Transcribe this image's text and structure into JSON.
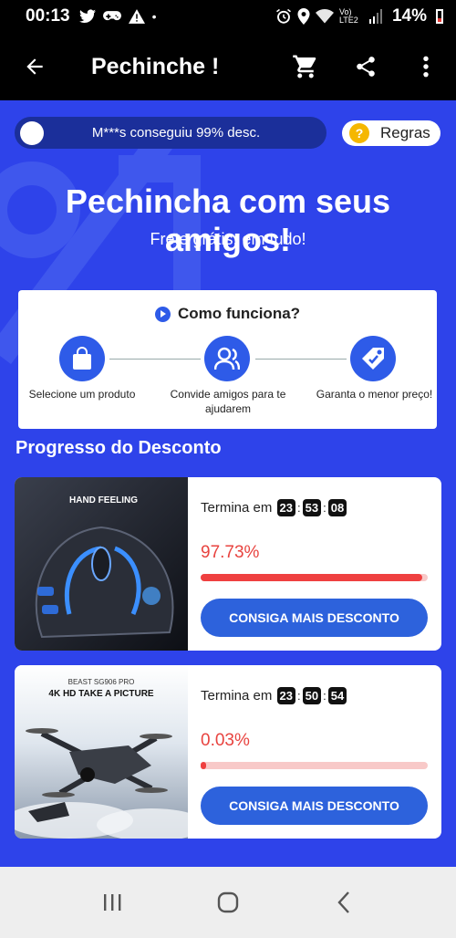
{
  "status_bar": {
    "time": "00:13",
    "network_label": "Vo) LTE2",
    "battery": "14%"
  },
  "app_bar": {
    "title": "Pechinche !"
  },
  "ticker": {
    "text": "M***s conseguiu 99% desc."
  },
  "rules": {
    "icon_char": "?",
    "label": "Regras"
  },
  "hero": {
    "title": "Pechincha com seus amigos!",
    "subtitle": "Frete grátis, em tudo!"
  },
  "how_it_works": {
    "title": "Como funciona?",
    "steps": [
      {
        "label": "Selecione um produto",
        "icon": "shopping-bag-icon"
      },
      {
        "label": "Convide amigos para te ajudarem",
        "icon": "user-add-icon"
      },
      {
        "label": "Garanta o menor preço!",
        "icon": "price-tag-icon"
      }
    ]
  },
  "progress": {
    "title": "Progresso do Desconto",
    "items": [
      {
        "image_caption": "HAND FEELING",
        "ends_label": "Termina em",
        "timer": {
          "h": "23",
          "m": "53",
          "s": "08"
        },
        "percent": "97.73%",
        "progress_value": 0.9773,
        "button": "CONSIGA MAIS DESCONTO"
      },
      {
        "image_caption_top": "BEAST SG906 PRO",
        "image_caption": "4K HD TAKE A PICTURE",
        "ends_label": "Termina em",
        "timer": {
          "h": "23",
          "m": "50",
          "s": "54"
        },
        "percent": "0.03%",
        "progress_value": 0.0003,
        "button": "CONSIGA MAIS DESCONTO"
      }
    ]
  },
  "colors": {
    "background": "#2e43ea",
    "accent_button": "#2d62dc",
    "percent_red": "#e8433f"
  }
}
